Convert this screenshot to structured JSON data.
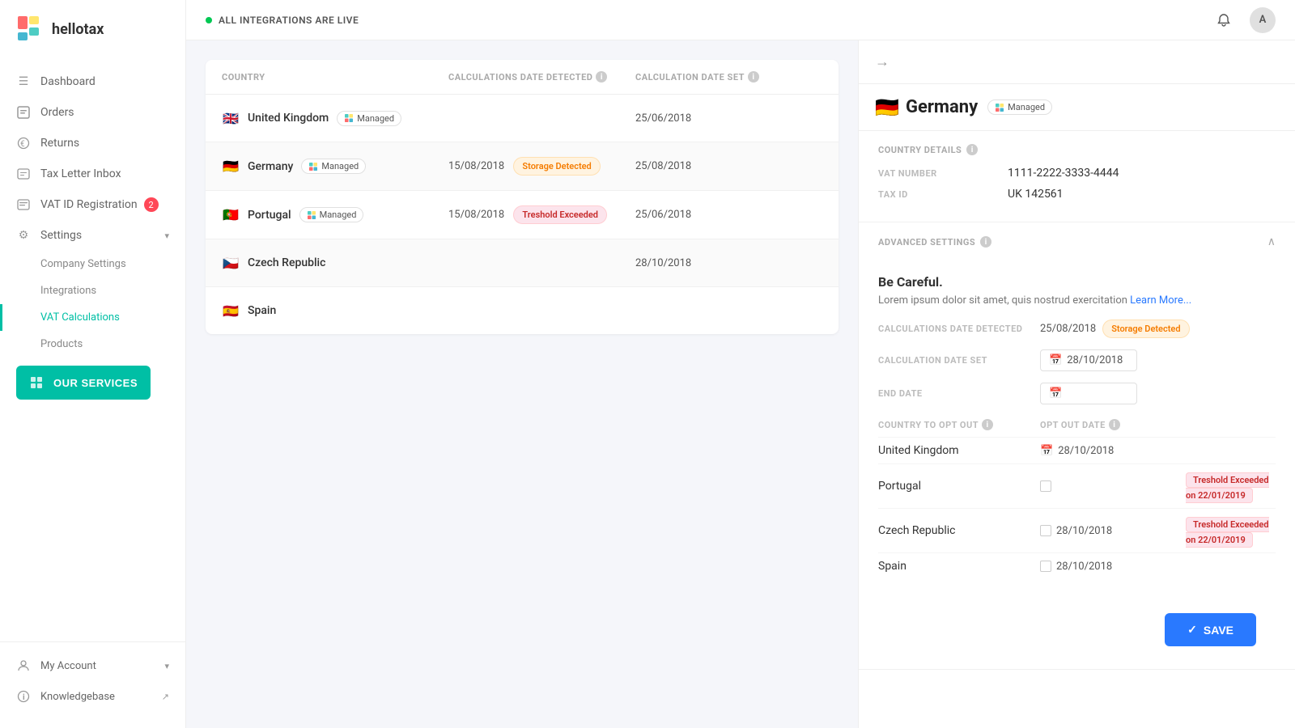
{
  "app": {
    "logo": "hellotax",
    "status": "ALL INTEGRATIONS ARE LIVE"
  },
  "sidebar": {
    "nav_items": [
      {
        "id": "dashboard",
        "label": "Dashboard",
        "icon": "☰"
      },
      {
        "id": "orders",
        "label": "Orders",
        "icon": "📄"
      },
      {
        "id": "returns",
        "label": "Returns",
        "icon": "↩"
      },
      {
        "id": "tax-letter",
        "label": "Tax Letter Inbox",
        "icon": "📋"
      },
      {
        "id": "vat-id",
        "label": "VAT ID Registration",
        "icon": "📑",
        "badge": "2"
      },
      {
        "id": "settings",
        "label": "Settings",
        "icon": "⚙",
        "expanded": true
      }
    ],
    "sub_items": [
      {
        "id": "company-settings",
        "label": "Company Settings"
      },
      {
        "id": "integrations",
        "label": "Integrations"
      },
      {
        "id": "vat-calculations",
        "label": "VAT Calculations",
        "active": true
      },
      {
        "id": "products",
        "label": "Products"
      }
    ],
    "our_services": "OUR SERVICES",
    "bottom_items": [
      {
        "id": "my-account",
        "label": "My Account",
        "icon": "👤",
        "has_arrow": true
      },
      {
        "id": "knowledgebase",
        "label": "Knowledgebase",
        "icon": "ℹ",
        "external": true
      }
    ]
  },
  "topbar": {
    "avatar_label": "A"
  },
  "table": {
    "columns": [
      {
        "id": "country",
        "label": "COUNTRY"
      },
      {
        "id": "calc-date",
        "label": "CALCULATIONS DATE DETECTED"
      },
      {
        "id": "calc-date-set",
        "label": "CALCULATION DATE SET"
      }
    ],
    "rows": [
      {
        "country": "United Kingdom",
        "flag": "🇬🇧",
        "managed": true,
        "calc_date": "",
        "calc_date_set": "25/06/2018",
        "status": ""
      },
      {
        "country": "Germany",
        "flag": "🇩🇪",
        "managed": true,
        "calc_date": "15/08/2018",
        "calc_date_set": "25/08/2018",
        "status": "Storage Detected",
        "status_type": "storage"
      },
      {
        "country": "Portugal",
        "flag": "🇵🇹",
        "managed": true,
        "calc_date": "15/08/2018",
        "calc_date_set": "25/06/2018",
        "status": "Treshold Exceeded",
        "status_type": "threshold"
      },
      {
        "country": "Czech Republic",
        "flag": "🇨🇿",
        "managed": false,
        "calc_date": "",
        "calc_date_set": "28/10/2018",
        "status": ""
      },
      {
        "country": "Spain",
        "flag": "🇪🇸",
        "managed": false,
        "calc_date": "",
        "calc_date_set": "",
        "status": ""
      }
    ]
  },
  "detail": {
    "country": "Germany",
    "flag": "🇩🇪",
    "managed_label": "Managed",
    "sections": {
      "country_details": {
        "title": "COUNTRY DETAILS",
        "vat_number_label": "VAT NUMBER",
        "vat_number_value": "1111-2222-3333-4444",
        "tax_id_label": "TAX ID",
        "tax_id_value": "UK 142561"
      },
      "advanced_settings": {
        "title": "ADVANCED SETTINGS",
        "be_careful": "Be Careful.",
        "description": "Lorem ipsum dolor sit amet, quis nostrud exercitation",
        "learn_more": "Learn More...",
        "calc_date_label": "CALCULATIONS DATE DETECTED",
        "calc_date_value": "25/08/2018",
        "calc_date_status": "Storage Detected",
        "calc_date_set_label": "CALCULATION DATE SET",
        "calc_date_set_value": "28/10/2018",
        "end_date_label": "END DATE",
        "opt_out_label": "COUNTRY TO OPT OUT",
        "opt_out_date_label": "OPT OUT DATE",
        "opt_out_rows": [
          {
            "country": "United Kingdom",
            "date": "28/10/2018",
            "badge": ""
          },
          {
            "country": "Portugal",
            "date": "",
            "badge": "Treshold Exceeded on 22/01/2019"
          },
          {
            "country": "Czech Republic",
            "date": "28/10/2018",
            "badge": "Treshold Exceeded on 22/01/2019"
          },
          {
            "country": "Spain",
            "date": "28/10/2018",
            "badge": ""
          }
        ],
        "save_label": "SAVE"
      }
    }
  }
}
